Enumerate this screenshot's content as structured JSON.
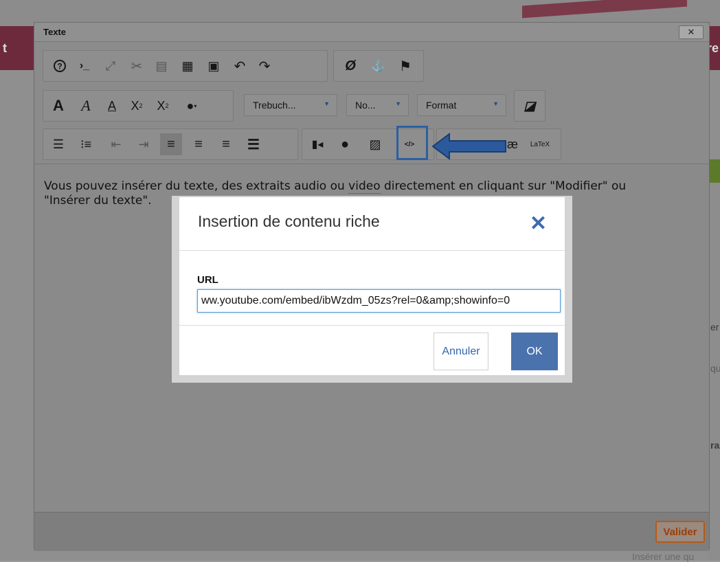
{
  "background": {
    "ribbon_left": "t",
    "ribbon_right": "re",
    "frag_1": "er",
    "frag_2": "qu",
    "frag_3": "ra",
    "bottom_input_placeholder": "Insérer une qu"
  },
  "editor": {
    "title": "Texte",
    "close_label": "✕",
    "toolbar": {
      "font_combo": "Trebuch...",
      "size_combo": "No...",
      "format_combo": "Format",
      "latex_label": "LaTeX"
    },
    "content_text_part1": "Vous pouvez insérer du texte, des extraits audio ou ",
    "content_text_spell": "video",
    "content_text_part2": " directement en cliquant sur \"Modifier\" ou \"Insérer du texte\".",
    "validate_label": "Valider"
  },
  "dialog": {
    "title": "Insertion de contenu riche",
    "close_label": "✕",
    "url_label": "URL",
    "url_value": "ww.youtube.com/embed/ibWzdm_05zs?rel=0&amp;showinfo=0",
    "cancel_label": "Annuler",
    "ok_label": "OK"
  },
  "colors": {
    "accent_blue": "#3c6bb0",
    "ok_button": "#4a73ad",
    "validate_orange": "#b85a14",
    "highlight_box": "#2b5fa3"
  }
}
